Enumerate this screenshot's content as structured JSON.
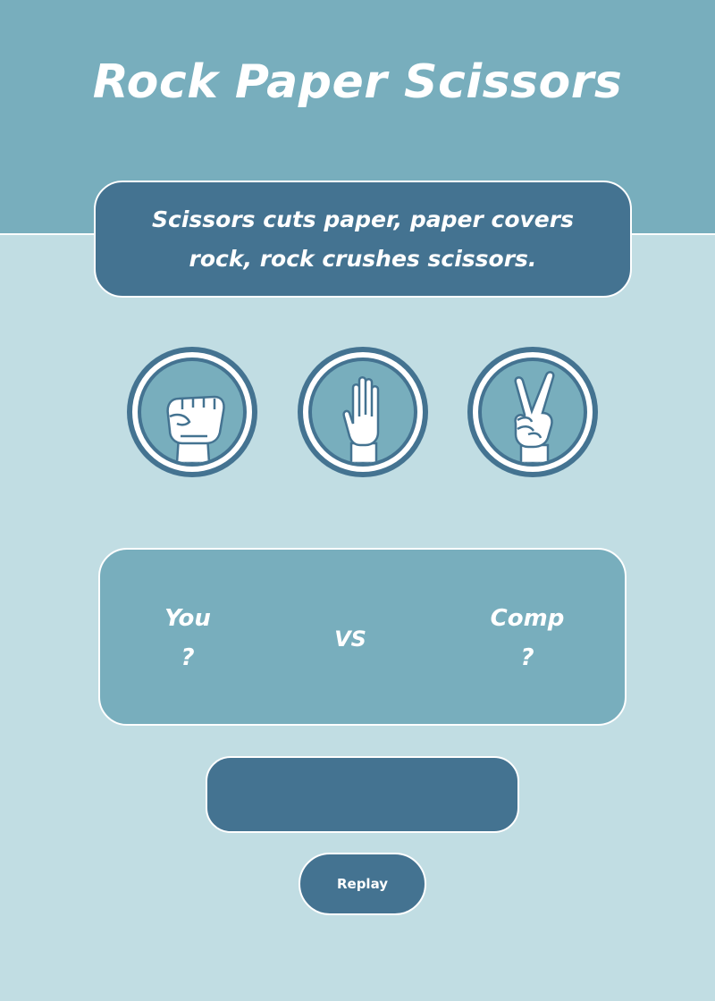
{
  "header": {
    "title": "Rock Paper Scissors"
  },
  "rules": {
    "text": "Scissors cuts paper, paper covers rock, rock crushes scissors."
  },
  "choices": [
    {
      "id": "rock",
      "icon": "rock-hand-icon"
    },
    {
      "id": "paper",
      "icon": "paper-hand-icon"
    },
    {
      "id": "scissors",
      "icon": "scissors-hand-icon"
    }
  ],
  "scoreboard": {
    "you_label": "You",
    "you_value": "?",
    "vs_label": "VS",
    "comp_label": "Comp",
    "comp_value": "?"
  },
  "result": {
    "text": ""
  },
  "controls": {
    "replay_label": "Replay"
  },
  "colors": {
    "header_band": "#78aebd",
    "background": "#c1dde3",
    "dark_accent": "#447391",
    "text": "#ffffff"
  }
}
